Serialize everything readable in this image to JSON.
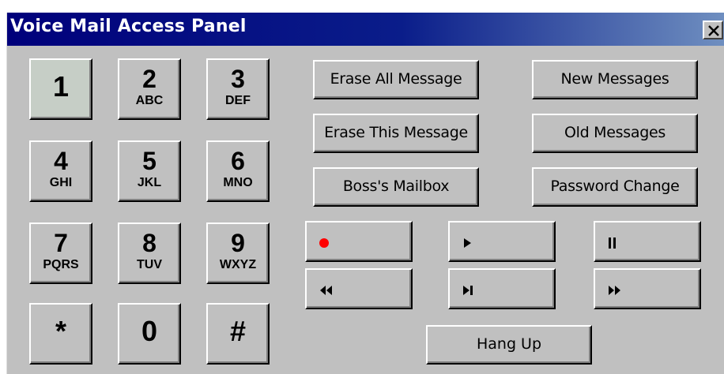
{
  "window": {
    "title": "Voice Mail Access Panel",
    "close_glyph": "×"
  },
  "keypad": [
    {
      "digit": "1",
      "letters": ""
    },
    {
      "digit": "2",
      "letters": "ABC"
    },
    {
      "digit": "3",
      "letters": "DEF"
    },
    {
      "digit": "4",
      "letters": "GHI"
    },
    {
      "digit": "5",
      "letters": "JKL"
    },
    {
      "digit": "6",
      "letters": "MNO"
    },
    {
      "digit": "7",
      "letters": "PQRS"
    },
    {
      "digit": "8",
      "letters": "TUV"
    },
    {
      "digit": "9",
      "letters": "WXYZ"
    },
    {
      "digit": "*",
      "letters": ""
    },
    {
      "digit": "0",
      "letters": ""
    },
    {
      "digit": "#",
      "letters": ""
    }
  ],
  "commands": {
    "erase_all": "Erase All Message",
    "new_messages": "New Messages",
    "erase_this": "Erase This Message",
    "old_messages": "Old Messages",
    "boss_mailbox": "Boss's Mailbox",
    "password_change": "Password Change",
    "hang_up": "Hang Up"
  },
  "media_controls": [
    {
      "name": "record",
      "icon": "record-icon"
    },
    {
      "name": "play",
      "icon": "play-icon"
    },
    {
      "name": "pause",
      "icon": "pause-icon"
    },
    {
      "name": "rewind",
      "icon": "rewind-icon"
    },
    {
      "name": "skip",
      "icon": "skip-next-icon"
    },
    {
      "name": "fast_forward",
      "icon": "fast-forward-icon"
    }
  ],
  "colors": {
    "record": "#ff0000",
    "titlebar": "#00007b",
    "face": "#c0c0c0"
  }
}
